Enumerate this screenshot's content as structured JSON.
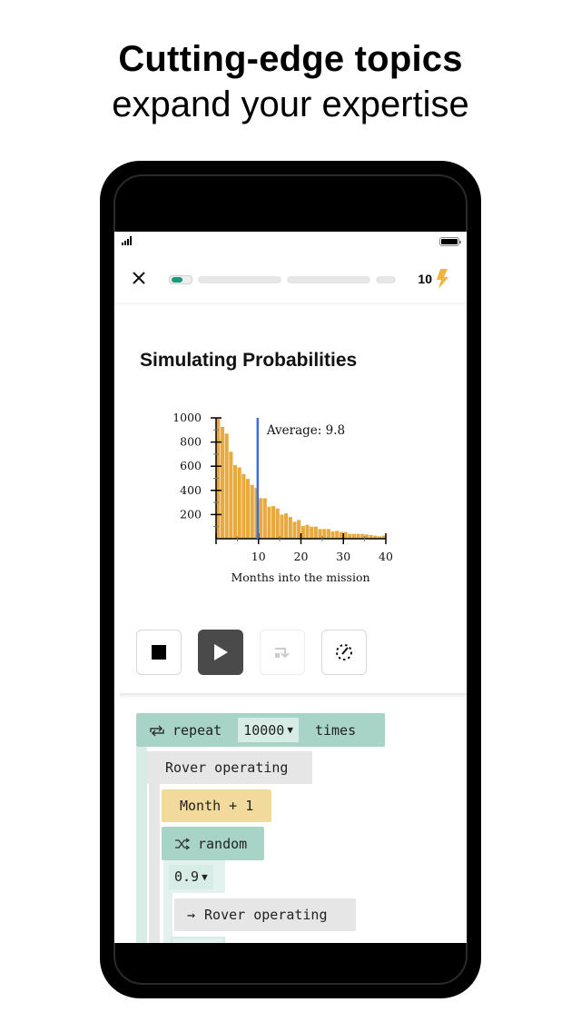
{
  "hero": {
    "headline": "Cutting-edge topics",
    "subheadline": "expand your expertise"
  },
  "topbar": {
    "close_icon": "close-icon",
    "progress_segments": 4,
    "progress_current": 0.3,
    "energy_count": "10",
    "energy_icon": "lightning-bolt-icon",
    "colors": {
      "progress": "#1a9a78",
      "energy": "#f2b53c"
    }
  },
  "lesson": {
    "title": "Simulating Probabilities"
  },
  "chart_data": {
    "type": "bar",
    "title": "",
    "xlabel": "Months into the mission",
    "ylabel": "",
    "xlim": [
      0,
      40
    ],
    "ylim": [
      0,
      1000
    ],
    "x_ticks": [
      "10",
      "20",
      "30",
      "40"
    ],
    "y_ticks": [
      "200",
      "400",
      "600",
      "800",
      "1000"
    ],
    "categories": [
      1,
      2,
      3,
      4,
      5,
      6,
      7,
      8,
      9,
      10,
      11,
      12,
      13,
      14,
      15,
      16,
      17,
      18,
      19,
      20,
      21,
      22,
      23,
      24,
      25,
      26,
      27,
      28,
      29,
      30,
      31,
      32,
      33,
      34,
      35,
      36,
      37,
      38,
      39,
      40
    ],
    "values": [
      1000,
      925,
      870,
      720,
      610,
      590,
      535,
      495,
      445,
      420,
      335,
      335,
      265,
      270,
      250,
      200,
      210,
      180,
      140,
      155,
      105,
      115,
      100,
      100,
      80,
      80,
      80,
      60,
      65,
      55,
      55,
      40,
      40,
      40,
      40,
      35,
      30,
      25,
      20,
      25
    ],
    "bar_color": "#e8a93e",
    "annotation": {
      "label": "Average:",
      "value": "9.8",
      "x": 9.8,
      "color": "#3b6fe0"
    }
  },
  "controls": [
    {
      "name": "stop-button",
      "icon": "stop-icon"
    },
    {
      "name": "play-button",
      "icon": "play-icon"
    },
    {
      "name": "step-button",
      "icon": "step-icon",
      "disabled": true
    },
    {
      "name": "speed-button",
      "icon": "speed-dial-icon"
    }
  ],
  "code": {
    "repeat_label": "repeat",
    "repeat_count": "10000",
    "times_label": "times",
    "state_label": "Rover operating",
    "month_expr": "Month + 1",
    "random_label": "random",
    "probability": "0.9",
    "transition_label": "Rover operating",
    "colors": {
      "control": "#a7d4c7",
      "state": "#e6e6e6",
      "expr": "#f2d99c"
    }
  }
}
